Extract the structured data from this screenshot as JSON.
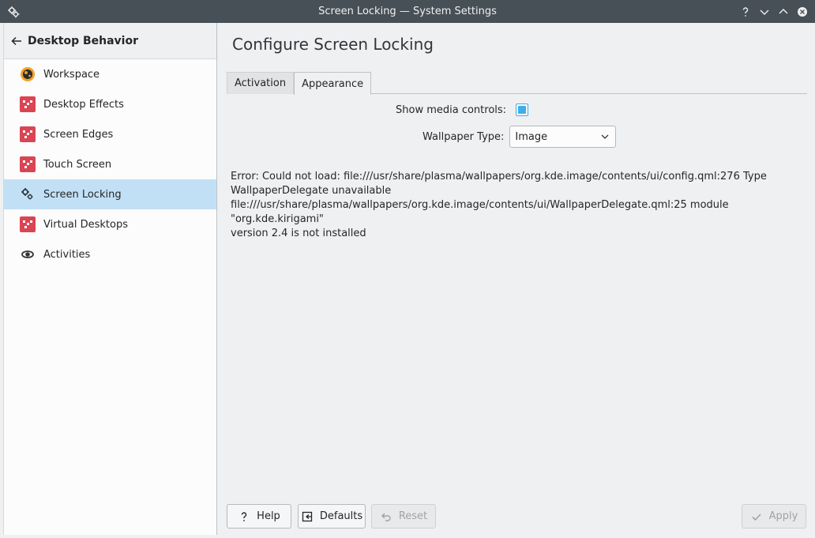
{
  "window": {
    "title": "Screen Locking — System Settings",
    "titlebar_bg": "#475057"
  },
  "sidebar": {
    "header_label": "Desktop Behavior",
    "items": [
      {
        "label": "Workspace",
        "icon": "workspace-icon"
      },
      {
        "label": "Desktop Effects",
        "icon": "desktop-effects-icon"
      },
      {
        "label": "Screen Edges",
        "icon": "screen-edges-icon"
      },
      {
        "label": "Touch Screen",
        "icon": "touch-screen-icon"
      },
      {
        "label": "Screen Locking",
        "icon": "screen-locking-icon",
        "selected": true
      },
      {
        "label": "Virtual Desktops",
        "icon": "virtual-desktops-icon"
      },
      {
        "label": "Activities",
        "icon": "activities-icon"
      }
    ],
    "selected_color": "#c2e0f5"
  },
  "main": {
    "page_title": "Configure Screen Locking",
    "tabs": [
      {
        "label": "Activation",
        "active": false
      },
      {
        "label": "Appearance",
        "active": true
      }
    ],
    "show_media_controls_label": "Show media controls:",
    "show_media_controls_checked": true,
    "wallpaper_type_label": "Wallpaper Type:",
    "wallpaper_type_value": "Image",
    "error_message": "Error: Could not load: file:///usr/share/plasma/wallpapers/org.kde.image/contents/ui/config.qml:276 Type\nWallpaperDelegate unavailable\nfile:///usr/share/plasma/wallpapers/org.kde.image/contents/ui/WallpaperDelegate.qml:25 module \"org.kde.kirigami\"\nversion 2.4 is not installed"
  },
  "buttons": {
    "help": "Help",
    "defaults": "Defaults",
    "reset": "Reset",
    "apply": "Apply"
  },
  "accent_color": "#3daee9"
}
